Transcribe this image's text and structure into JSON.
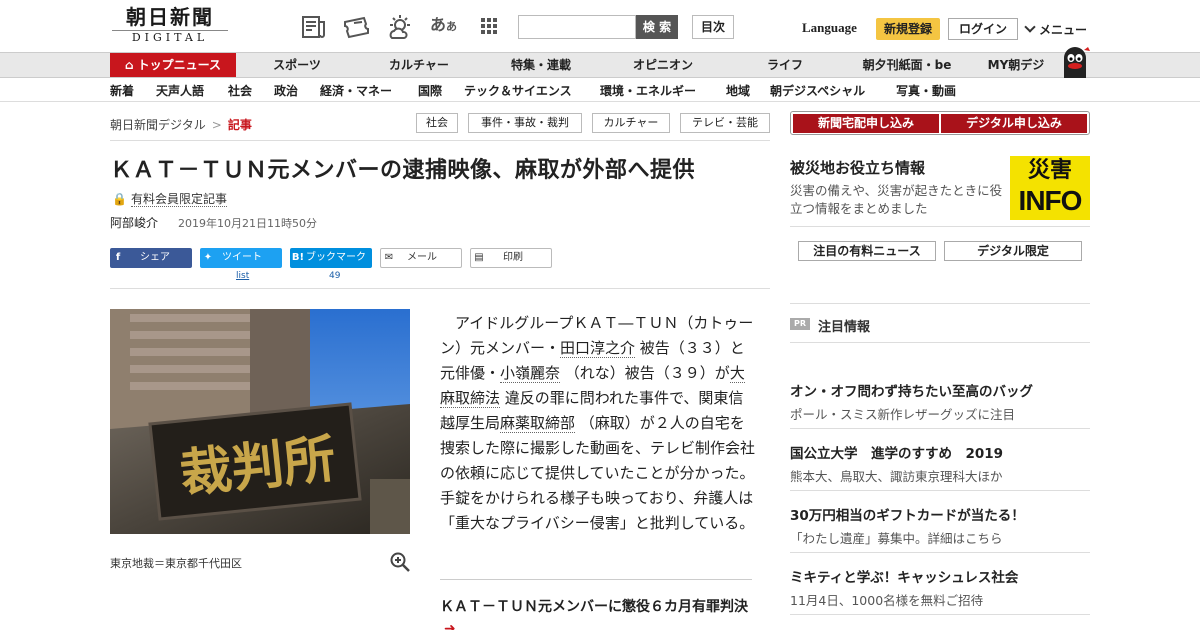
{
  "header": {
    "logo_top": "朝日新聞",
    "logo_bottom": "DIGITAL",
    "search_button": "検 索",
    "search_placeholder": "",
    "toc_button": "目次",
    "language": "Language",
    "register": "新規登録",
    "login": "ログイン",
    "menu": "メニュー"
  },
  "nav": {
    "home": "トップニュース",
    "items": [
      "スポーツ",
      "カルチャー",
      "特集・連載",
      "オピニオン",
      "ライフ",
      "朝夕刊紙面・be",
      "MY朝デジ"
    ]
  },
  "subnav": [
    "新着",
    "天声人語",
    "社会",
    "政治",
    "経済・マネー",
    "国際",
    "テック＆サイエンス",
    "環境・エネルギー",
    "地域",
    "朝デジスペシャル",
    "写真・動画"
  ],
  "breadcrumb": {
    "root": "朝日新聞デジタル",
    "sep": ">",
    "current": "記事"
  },
  "tags": [
    "社会",
    "事件・事故・裁判",
    "カルチャー",
    "テレビ・芸能"
  ],
  "article": {
    "title": "ＫＡＴ－ＴＵＮ元メンバーの逮捕映像、麻取が外部へ提供",
    "paid_label": "有料会員限定記事",
    "author": "阿部峻介",
    "date": "2019年10月21日11時50分",
    "share": {
      "facebook": "シェア",
      "twitter": "ツイート",
      "hatena": "ブックマーク",
      "mail": "メール",
      "print": "印刷",
      "twitter_count": "list",
      "hatena_count": "49"
    },
    "photo_sign": "裁判所",
    "caption": "東京地裁＝東京都千代田区",
    "body": {
      "p1": "　アイドルグループＫＡＴ―ＴＵＮ（カトゥーン）元メンバー・",
      "link1": "田口淳之介",
      "p2": " 被告（３３）と元俳優・",
      "link2": "小嶺麗奈",
      "p3": " （れな）被告（３９）が",
      "link3": "大麻取締法",
      "p4": " 違反の罪に問われた事件で、関東信越厚生局",
      "link4": "麻薬取締部",
      "p5": " （麻取）が２人の自宅を捜索した際に撮影した動画を、テレビ制作会社の依頼に応じて提供していたことが分かった。手錠をかけられる様子も映っており、弁護人は「重大なプライバシー侵害」と批判している。"
    },
    "related": "ＫＡＴ－ＴＵＮ元メンバーに懲役６カ月有罪判決"
  },
  "sidebar": {
    "btn_delivery": "新聞宅配申し込み",
    "btn_digital": "デジタル申し込み",
    "disaster_title": "被災地お役立ち情報",
    "disaster_desc": "災害の備えや、災害が起きたときに役立つ情報をまとめました",
    "disaster_img_top": "災害",
    "disaster_img_bottom": "INFO",
    "tab1": "注目の有料ニュース",
    "tab2": "デジタル限定",
    "pr_badge": "PR",
    "pr_title": "注目情報",
    "pr_items": [
      {
        "title": "オン・オフ問わず持ちたい至高のバッグ",
        "sub": "ポール・スミス新作レザーグッズに注目"
      },
      {
        "title": "国公立大学　進学のすすめ　2019",
        "sub": "熊本大、鳥取大、諏訪東京理科大ほか"
      },
      {
        "title": "30万円相当のギフトカードが当たる！",
        "sub": "「わたし遺産」募集中。詳細はこちら"
      },
      {
        "title": "ミキティと学ぶ！キャッシュレス社会",
        "sub": "11月4日、1000名様を無料ご招待"
      }
    ]
  },
  "colors": {
    "brand_red": "#c8161d",
    "register_yellow": "#f4c542",
    "facebook": "#3b5998",
    "twitter": "#1da1f2",
    "hatena": "#008fde"
  }
}
